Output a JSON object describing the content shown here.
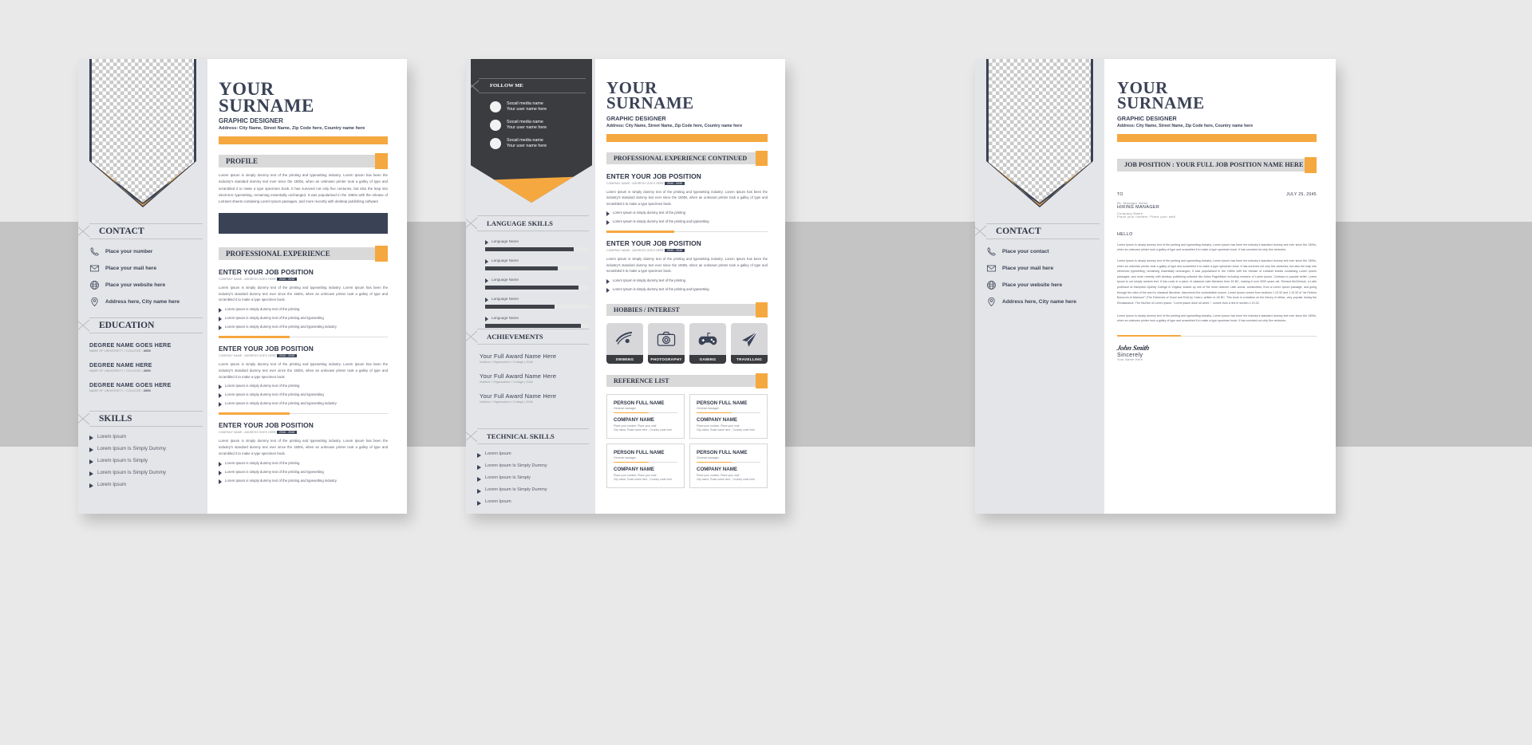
{
  "brand": {
    "orange": "#f5a83f",
    "navy": "#3a4256",
    "dark": "#3b3c40",
    "grey": "#e4e5e8"
  },
  "header": {
    "name_line1": "YOUR",
    "name_line2": "SURNAME",
    "role": "GRAPHIC DESIGNER",
    "address": "Address: City Name, Street Name, Zip Code here, Country name here"
  },
  "page1": {
    "profile": {
      "heading": "PROFILE",
      "body": "Lorem Ipsum is simply dummy text of the printing and typesetting industry. Lorem Ipsum has been the industry's standard dummy text ever since the 1500s, when an unknown printer took a galley of type and scrambled it to make a type specimen book. It has survived not only five centuries, but also the leap into electronic typesetting, remaining essentially unchanged. It was popularised in the 1960s with the release of Letraset sheets containing Lorem Ipsum passages, and more recently with desktop publishing software"
    },
    "contact": {
      "heading": "CONTACT",
      "items": [
        {
          "icon": "phone-icon",
          "label": "Place your number"
        },
        {
          "icon": "mail-icon",
          "label": "Place your mail here"
        },
        {
          "icon": "globe-icon",
          "label": "Place your website here"
        },
        {
          "icon": "location-pin-icon",
          "label": "Address here, City name here"
        }
      ]
    },
    "education": {
      "heading": "EDUCATION",
      "items": [
        {
          "degree": "DEGREE NAME GOES HERE",
          "school": "NAME OF UNIVERSITY / COLLEGE | ",
          "year": "2050"
        },
        {
          "degree": "DEGREE NAME HERE",
          "school": "NAME OF UNIVERSITY / COLLEGE | ",
          "year": "2050"
        },
        {
          "degree": "DEGREE NAME GOES HERE",
          "school": "NAME OF UNIVERSITY / COLLEGE | ",
          "year": "2050"
        }
      ]
    },
    "skills": {
      "heading": "SKILLS",
      "items": [
        "Lorem Ipsum",
        "Lorem Ipsum Is Simply Dummy",
        "Lorem Ipsum Is Simply",
        "Lorem Ipsum Is Simply Dummy",
        "Lorem Ipsum"
      ]
    },
    "experience": {
      "heading": "PROFESSIONAL EXPERIENCE",
      "jobs": [
        {
          "title": "ENTER YOUR JOB POSITION",
          "company": "COMPANY NAME - ADDRESS GOES HERE",
          "year": "2040 - 2045",
          "body": "Lorem Ipsum is simply dummy text of the printing and typesetting industry. Lorem Ipsum has been the industry's standard dummy text ever since the 1500s, when an unknown printer took a galley of type and scrambled it to make a type specimen book.",
          "bullets": [
            "Lorem Ipsum is simply dummy text of the printing",
            "Lorem Ipsum is simply dummy text of the printing and typesetting",
            "Lorem Ipsum is simply dummy text of the printing and typesetting industry"
          ]
        },
        {
          "title": "ENTER YOUR JOB POSITION",
          "company": "COMPANY NAME - ADDRESS GOES HERE",
          "year": "2040 - 2045",
          "body": "Lorem Ipsum is simply dummy text of the printing and typesetting industry. Lorem Ipsum has been the industry's standard dummy text ever since the 1500s, when an unknown printer took a galley of type and scrambled it to make a type specimen book.",
          "bullets": [
            "Lorem Ipsum is simply dummy text of the printing",
            "Lorem Ipsum is simply dummy text of the printing and typesetting",
            "Lorem Ipsum is simply dummy text of the printing and typesetting industry"
          ]
        },
        {
          "title": "ENTER YOUR JOB POSITION",
          "company": "COMPANY NAME - ADDRESS GOES HERE",
          "year": "2040 - 2045",
          "body": "Lorem Ipsum is simply dummy text of the printing and typesetting industry. Lorem Ipsum has been the industry's standard dummy text ever since the 1500s, when an unknown printer took a galley of type and scrambled it to make a type specimen book.",
          "bullets": [
            "Lorem Ipsum is simply dummy text of the printing",
            "Lorem Ipsum is simply dummy text of the printing and typesetting",
            "Lorem Ipsum is simply dummy text of the printing and typesetting industry"
          ]
        }
      ]
    }
  },
  "page2": {
    "follow": {
      "heading": "FOLLOW ME",
      "items": [
        {
          "network": "Socail media name",
          "handle": "Your user name here"
        },
        {
          "network": "Socail media name",
          "handle": "Your user name here"
        },
        {
          "network": "Socail media name",
          "handle": "Your user name here"
        }
      ]
    },
    "language": {
      "heading": "LANGUAGE SKILLS",
      "items": [
        {
          "label": "Language Name",
          "level": 85
        },
        {
          "label": "Language Name",
          "level": 70
        },
        {
          "label": "Language Name",
          "level": 90
        },
        {
          "label": "Language Name",
          "level": 67
        },
        {
          "label": "Language Name",
          "level": 92
        }
      ]
    },
    "achievements": {
      "heading": "ACHIEVEMENTS",
      "items": [
        {
          "award": "Your Full Award Name Here",
          "meta": "Institute / Organisation / Collage | 2046"
        },
        {
          "award": "Your Full Award Name Here",
          "meta": "Institute / Organisation / Collage | 2046"
        },
        {
          "award": "Your Full Award Name Here",
          "meta": "Institute / Organisation / Collage | 2046"
        }
      ]
    },
    "technical": {
      "heading": "TECHNICAL SKILLS",
      "items": [
        "Lorem Ipsum",
        "Lorem Ipsum Is Simply Dummy",
        "Lorem Ipsum Is Simply",
        "Lorem Ipsum Is Simply Dummy",
        "Lorem Ipsum"
      ]
    },
    "experience": {
      "heading": "PROFESSIONAL EXPERIENCE CONTINUED",
      "jobs": [
        {
          "title": "ENTER YOUR JOB POSITION",
          "company": "COMPANY NAME - ADDRESS GOES HERE",
          "year": "2040 - 2045",
          "body": "Lorem Ipsum is simply dummy text of the printing and typesetting industry. Lorem Ipsum has been the industry's standard dummy text ever since the 1500s, when an unknown printer took a galley of type and scrambled it to make a type specimen book.",
          "bullets": [
            "Lorem Ipsum is simply dummy text of the printing",
            "Lorem Ipsum is simply dummy text of the printing and typesetting"
          ]
        },
        {
          "title": "ENTER YOUR JOB POSITION",
          "company": "COMPANY NAME - ADDRESS GOES HERE",
          "year": "2040 - 2045",
          "body": "Lorem Ipsum is simply dummy text of the printing and typesetting industry. Lorem Ipsum has been the industry's standard dummy text ever since the 1500s, when an unknown printer took a galley of type and scrambled it to make a type specimen book.",
          "bullets": [
            "Lorem Ipsum is simply dummy text of the printing",
            "Lorem Ipsum is simply dummy text of the printing and typesetting"
          ]
        }
      ]
    },
    "hobbies": {
      "heading": "HOBBIES / INTEREST",
      "items": [
        {
          "icon": "swimmer-icon",
          "label": "SWIMING"
        },
        {
          "icon": "camera-icon",
          "label": "PHOTOGRAPHY"
        },
        {
          "icon": "gamepad-icon",
          "label": "GAMING"
        },
        {
          "icon": "paper-plane-icon",
          "label": "TRAVELLING"
        }
      ]
    },
    "reference": {
      "heading": "REFERENCE LIST",
      "items": [
        {
          "name": "PERSON FULL NAME",
          "role": "General manager",
          "company": "COMPANY NAME",
          "line1": "Place your number, Place your mail",
          "line2": "City name, Road name here , Country code here"
        },
        {
          "name": "PERSON FULL NAME",
          "role": "General manager",
          "company": "COMPANY NAME",
          "line1": "Place your number, Place your mail",
          "line2": "City name, Road name here , Country code here"
        },
        {
          "name": "PERSON FULL NAME",
          "role": "General manager",
          "company": "COMPANY NAME",
          "line1": "Place your number, Place your mail",
          "line2": "City name, Road name here , Country code here"
        },
        {
          "name": "PERSON FULL NAME",
          "role": "General manager",
          "company": "COMPANY NAME",
          "line1": "Place your number, Place your mail",
          "line2": "City name, Road name here , Country code here"
        }
      ]
    }
  },
  "page3": {
    "contact": {
      "heading": "CONTACT",
      "items": [
        {
          "icon": "phone-icon",
          "label": "Place your contact"
        },
        {
          "icon": "mail-icon",
          "label": "Place your mail here"
        },
        {
          "icon": "globe-icon",
          "label": "Place your website here"
        },
        {
          "icon": "location-pin-icon",
          "label": "Address here, City name here"
        }
      ]
    },
    "job_position_bar": "JOB POSITION : YOUR FULL JOB POSITION NAME HERE",
    "letter": {
      "to_label": "TO",
      "date": "JULY 25, 2045",
      "recipient_prefix": "Mr. Manager Name",
      "recipient": "HIRING MANAGER",
      "recipient_company": "Company Name",
      "recipient_contact": "Place your number, Place your mail",
      "greeting": "HELLO",
      "para1": "Lorem Ipsum is simply dummy text of the printing and typesetting industry. Lorem Ipsum has been the industry's standard dummy text ever since the 1500s, when an unknown printer took a galley of type and scrambled it to make a type specimen book. It has survived not only five centuries.",
      "para2": "Lorem Ipsum is simply dummy text of the printing and typesetting industry. Lorem Ipsum has been the industry's standard dummy text ever since the 1500s, when an unknown printer took a galley of type and scrambled it to make a type specimen book. It has survived not only five centuries, but also the leap into electronic typesetting, remaining essentially unchanged. It was popularised in the 1960s with the release of Letraset sheets containing Lorem Ipsum passages, and more recently with desktop publishing software like Aldus PageMaker including versions of Lorem Ipsum. Contrary to popular belief, Lorem Ipsum is not simply random text. It has roots in a piece of classical Latin literature from 45 BC, making it over 2000 years old. Richard McClintock, a Latin professor at Hampden-Sydney College in Virginia, looked up one of the more obscure Latin words, consectetur, from a Lorem Ipsum passage, and going through the cites of the word in classical literature, discovered the undoubtable source. Lorem Ipsum comes from sections 1.10.32 and 1.10.33 of \"de Finibus Bonorum et Malorum\" (The Extremes of Good and Evil) by Cicero, written in 45 BC. This book is a treatise on the theory of ethics, very popular during the Renaissance. The first line of Lorem Ipsum, \"Lorem ipsum dolor sit amet..\", comes from a line in section 1.10.32.",
      "para3": "Lorem Ipsum is simply dummy text of the printing and typesetting industry. Lorem Ipsum has been the industry's standard dummy text ever since the 1500s, when an unknown printer took a galley of type and scrambled it to make a type specimen book. It has survived not only five centuries.",
      "signature": "John Smith",
      "closing": "Sincerely",
      "closing_sub": "Your Name Here"
    }
  }
}
